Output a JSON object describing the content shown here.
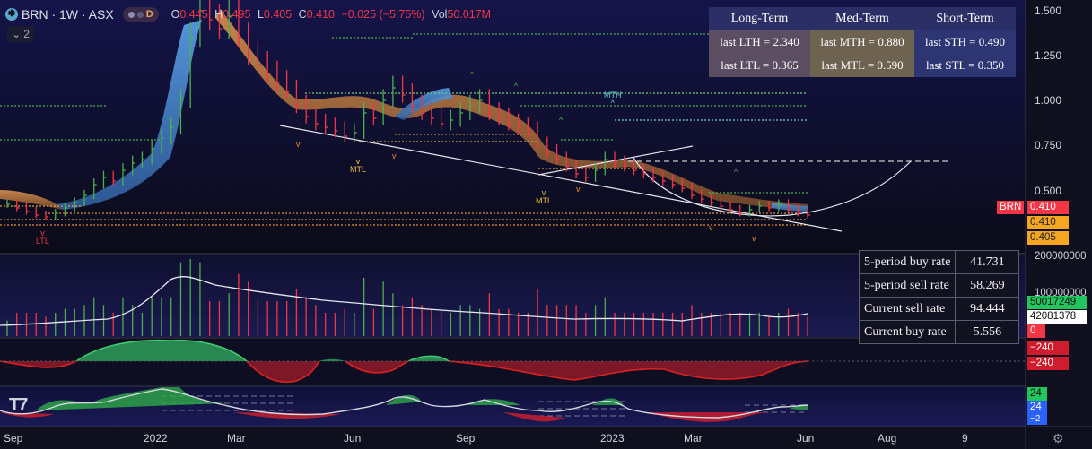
{
  "header": {
    "symbol": "BRN · 1W · ASX",
    "interval_badge": "D",
    "open_label": "O",
    "open": "0.445",
    "high_label": "H",
    "high": "0.495",
    "low_label": "L",
    "low": "0.405",
    "close_label": "C",
    "close": "0.410",
    "change": "−0.025 (−5.75%)",
    "vol_label": "Vol",
    "volume": "50.017M",
    "indicator_count": "2"
  },
  "regime_table": {
    "headers": [
      "Long-Term",
      "Med-Term",
      "Short-Term"
    ],
    "row1": [
      "last LTH = 2.340",
      "last MTH = 0.880",
      "last STH = 0.490"
    ],
    "row2": [
      "last LTL = 0.365",
      "last MTL = 0.590",
      "last STL = 0.350"
    ]
  },
  "rates_table": {
    "rows": [
      {
        "label": "5-period buy rate",
        "value": "41.731"
      },
      {
        "label": "5-period sell rate",
        "value": "58.269"
      },
      {
        "label": "Current sell rate",
        "value": "94.444"
      },
      {
        "label": "Current buy rate",
        "value": "5.556"
      }
    ]
  },
  "annotations": {
    "ltl": "LTL",
    "mtl1": "MTL",
    "mtl2": "MTL",
    "mth": "MTH"
  },
  "price_axis": {
    "ticks": [
      "1.500",
      "1.250",
      "1.000",
      "0.750",
      "0.500"
    ],
    "symbol_tag": "BRN",
    "price_tag": "0.410",
    "tag2": "0.410",
    "tag3": "0.405"
  },
  "volume_axis": {
    "top": "200000000",
    "mid": "100000000",
    "tag_green": "50017249",
    "tag_white": "42081378",
    "tag_red": "0"
  },
  "osc_axis": {
    "v1": "−240",
    "v2": "−240"
  },
  "rsi_axis": {
    "v1": "24",
    "v2": "24",
    "v3": "−2"
  },
  "time_axis": [
    "Sep",
    "2022",
    "Mar",
    "Jun",
    "Sep",
    "2023",
    "Mar",
    "Jun",
    "Aug",
    "9"
  ],
  "colors": {
    "up": "#4caf50",
    "down": "#f23645",
    "ribbon_blue": "#4a8fd6",
    "ribbon_orange": "#d08a4a",
    "bg": "#0f0f1d"
  },
  "chart_data": {
    "type": "bar",
    "title": "BRN · 1W · ASX",
    "ylim": [
      0.3,
      1.55
    ],
    "series": [
      {
        "name": "close",
        "values": [
          0.47,
          0.45,
          0.43,
          0.41,
          0.4,
          0.42,
          0.45,
          0.48,
          0.52,
          0.58,
          0.62,
          0.6,
          0.66,
          0.7,
          0.72,
          0.78,
          0.84,
          0.9,
          1.05,
          1.4,
          1.55,
          1.5,
          1.45,
          1.52,
          1.4,
          1.3,
          1.25,
          1.2,
          1.15,
          1.1,
          1.02,
          0.96,
          0.92,
          0.9,
          0.88,
          0.85,
          0.87,
          0.98,
          0.95,
          1.05,
          1.12,
          1.08,
          1.02,
          0.98,
          0.95,
          0.92,
          0.94,
          0.98,
          1.02,
          1.05,
          0.98,
          0.95,
          0.92,
          0.9,
          0.88,
          0.8,
          0.76,
          0.72,
          0.68,
          0.64,
          0.62,
          0.66,
          0.72,
          0.7,
          0.68,
          0.66,
          0.64,
          0.62,
          0.6,
          0.58,
          0.56,
          0.52,
          0.5,
          0.48,
          0.46,
          0.44,
          0.42,
          0.44,
          0.46,
          0.45,
          0.47,
          0.44,
          0.42,
          0.41
        ]
      }
    ],
    "levels": {
      "LTH": 2.34,
      "LTL": 0.365,
      "MTH": 0.88,
      "MTL": 0.59,
      "STH": 0.49,
      "STL": 0.35
    }
  }
}
